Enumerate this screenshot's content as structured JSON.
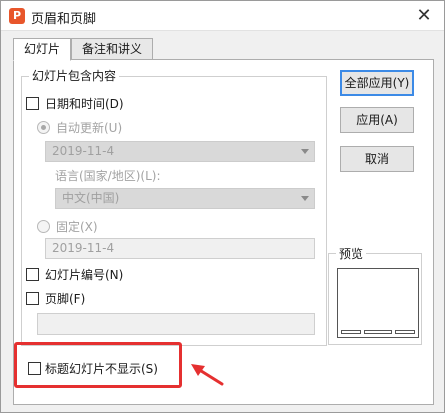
{
  "window": {
    "app_icon_glyph": "P",
    "title": "页眉和页脚",
    "close_glyph": "✕"
  },
  "tabs": [
    {
      "label": "幻灯片",
      "active": true
    },
    {
      "label": "备注和讲义",
      "active": false
    }
  ],
  "slide_group": {
    "legend": "幻灯片包含内容",
    "datetime": {
      "label": "日期和时间(D)",
      "checked": false
    },
    "auto_update": {
      "label": "自动更新(U)",
      "selected": true,
      "enabled": false
    },
    "date_format": {
      "value": "2019-11-4",
      "enabled": false
    },
    "language_label": "语言(国家/地区)(L):",
    "language": {
      "value": "中文(中国)",
      "enabled": false
    },
    "fixed": {
      "label": "固定(X)",
      "selected": false,
      "enabled": false
    },
    "fixed_value": "2019-11-4",
    "slide_number": {
      "label": "幻灯片编号(N)",
      "checked": false
    },
    "footer": {
      "label": "页脚(F)",
      "checked": false
    },
    "footer_text": ""
  },
  "title_slide_option": {
    "label": "标题幻灯片不显示(S)",
    "checked": false
  },
  "buttons": {
    "apply_all": "全部应用(Y)",
    "apply": "应用(A)",
    "cancel": "取消"
  },
  "preview": {
    "label": "预览"
  },
  "colors": {
    "highlight": "#e53030",
    "default_button_border": "#3c8ae6",
    "app_icon": "#e8562b"
  }
}
